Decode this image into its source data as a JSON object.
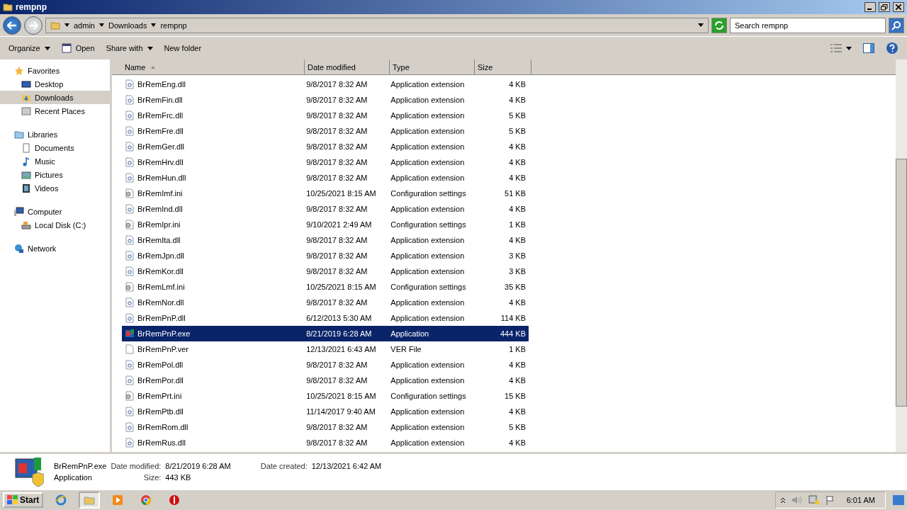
{
  "window": {
    "title": "rempnp"
  },
  "address": {
    "crumbs": [
      "admin",
      "Downloads",
      "rempnp"
    ],
    "search_placeholder": "Search rempnp"
  },
  "toolbar": [
    {
      "label": "Organize",
      "dropdown": true,
      "kind": "menu"
    },
    {
      "label": "Open",
      "dropdown": false,
      "kind": "open"
    },
    {
      "label": "Share with",
      "dropdown": true,
      "kind": "menu"
    },
    {
      "label": "New folder",
      "dropdown": false,
      "kind": "menu"
    }
  ],
  "sidebar": {
    "groups": [
      {
        "label": "Favorites",
        "kind": "star",
        "children": [
          {
            "label": "Desktop",
            "kind": "desktop",
            "selected": false
          },
          {
            "label": "Downloads",
            "kind": "downloads",
            "selected": true
          },
          {
            "label": "Recent Places",
            "kind": "recent",
            "selected": false
          }
        ]
      },
      {
        "label": "Libraries",
        "kind": "library",
        "children": [
          {
            "label": "Documents",
            "kind": "documents",
            "selected": false
          },
          {
            "label": "Music",
            "kind": "music",
            "selected": false
          },
          {
            "label": "Pictures",
            "kind": "pictures",
            "selected": false
          },
          {
            "label": "Videos",
            "kind": "videos",
            "selected": false
          }
        ]
      },
      {
        "label": "Computer",
        "kind": "computer",
        "children": [
          {
            "label": "Local Disk (C:)",
            "kind": "disk",
            "selected": false
          }
        ]
      },
      {
        "label": "Network",
        "kind": "network"
      }
    ]
  },
  "table": {
    "columns": [
      {
        "label": "Name",
        "sorted": true
      },
      {
        "label": "Date modified",
        "sorted": false
      },
      {
        "label": "Type",
        "sorted": false
      },
      {
        "label": "Size",
        "sorted": false
      }
    ],
    "rows": [
      {
        "name": "BrRemEng.dll",
        "date": "9/8/2017 8:32 AM",
        "type": "Application extension",
        "size": "4 KB",
        "kind": "dll",
        "selected": false
      },
      {
        "name": "BrRemFin.dll",
        "date": "9/8/2017 8:32 AM",
        "type": "Application extension",
        "size": "4 KB",
        "kind": "dll",
        "selected": false
      },
      {
        "name": "BrRemFrc.dll",
        "date": "9/8/2017 8:32 AM",
        "type": "Application extension",
        "size": "5 KB",
        "kind": "dll",
        "selected": false
      },
      {
        "name": "BrRemFre.dll",
        "date": "9/8/2017 8:32 AM",
        "type": "Application extension",
        "size": "5 KB",
        "kind": "dll",
        "selected": false
      },
      {
        "name": "BrRemGer.dll",
        "date": "9/8/2017 8:32 AM",
        "type": "Application extension",
        "size": "4 KB",
        "kind": "dll",
        "selected": false
      },
      {
        "name": "BrRemHrv.dll",
        "date": "9/8/2017 8:32 AM",
        "type": "Application extension",
        "size": "4 KB",
        "kind": "dll",
        "selected": false
      },
      {
        "name": "BrRemHun.dll",
        "date": "9/8/2017 8:32 AM",
        "type": "Application extension",
        "size": "4 KB",
        "kind": "dll",
        "selected": false
      },
      {
        "name": "BrRemImf.ini",
        "date": "10/25/2021 8:15 AM",
        "type": "Configuration settings",
        "size": "51 KB",
        "kind": "ini",
        "selected": false
      },
      {
        "name": "BrRemInd.dll",
        "date": "9/8/2017 8:32 AM",
        "type": "Application extension",
        "size": "4 KB",
        "kind": "dll",
        "selected": false
      },
      {
        "name": "BrRemIpr.ini",
        "date": "9/10/2021 2:49 AM",
        "type": "Configuration settings",
        "size": "1 KB",
        "kind": "ini",
        "selected": false
      },
      {
        "name": "BrRemIta.dll",
        "date": "9/8/2017 8:32 AM",
        "type": "Application extension",
        "size": "4 KB",
        "kind": "dll",
        "selected": false
      },
      {
        "name": "BrRemJpn.dll",
        "date": "9/8/2017 8:32 AM",
        "type": "Application extension",
        "size": "3 KB",
        "kind": "dll",
        "selected": false
      },
      {
        "name": "BrRemKor.dll",
        "date": "9/8/2017 8:32 AM",
        "type": "Application extension",
        "size": "3 KB",
        "kind": "dll",
        "selected": false
      },
      {
        "name": "BrRemLmf.ini",
        "date": "10/25/2021 8:15 AM",
        "type": "Configuration settings",
        "size": "35 KB",
        "kind": "ini",
        "selected": false
      },
      {
        "name": "BrRemNor.dll",
        "date": "9/8/2017 8:32 AM",
        "type": "Application extension",
        "size": "4 KB",
        "kind": "dll",
        "selected": false
      },
      {
        "name": "BrRemPnP.dll",
        "date": "6/12/2013 5:30 AM",
        "type": "Application extension",
        "size": "114 KB",
        "kind": "dll",
        "selected": false
      },
      {
        "name": "BrRemPnP.exe",
        "date": "8/21/2019 6:28 AM",
        "type": "Application",
        "size": "444 KB",
        "kind": "exe",
        "selected": true
      },
      {
        "name": "BrRemPnP.ver",
        "date": "12/13/2021 6:43 AM",
        "type": "VER File",
        "size": "1 KB",
        "kind": "ver",
        "selected": false
      },
      {
        "name": "BrRemPol.dll",
        "date": "9/8/2017 8:32 AM",
        "type": "Application extension",
        "size": "4 KB",
        "kind": "dll",
        "selected": false
      },
      {
        "name": "BrRemPor.dll",
        "date": "9/8/2017 8:32 AM",
        "type": "Application extension",
        "size": "4 KB",
        "kind": "dll",
        "selected": false
      },
      {
        "name": "BrRemPrt.ini",
        "date": "10/25/2021 8:15 AM",
        "type": "Configuration settings",
        "size": "15 KB",
        "kind": "ini",
        "selected": false
      },
      {
        "name": "BrRemPtb.dll",
        "date": "11/14/2017 9:40 AM",
        "type": "Application extension",
        "size": "4 KB",
        "kind": "dll",
        "selected": false
      },
      {
        "name": "BrRemRom.dll",
        "date": "9/8/2017 8:32 AM",
        "type": "Application extension",
        "size": "5 KB",
        "kind": "dll",
        "selected": false
      },
      {
        "name": "BrRemRus.dll",
        "date": "9/8/2017 8:32 AM",
        "type": "Application extension",
        "size": "4 KB",
        "kind": "dll",
        "selected": false
      }
    ]
  },
  "details": {
    "name": "BrRemPnP.exe",
    "type": "Application",
    "modified_label": "Date modified:",
    "modified": "8/21/2019 6:28 AM",
    "created_label": "Date created:",
    "created": "12/13/2021 6:42 AM",
    "size_label": "Size:",
    "size": "443 KB"
  },
  "taskbar": {
    "start": "Start",
    "apps": [
      {
        "kind": "ie",
        "selected": false
      },
      {
        "kind": "explorer",
        "selected": true
      },
      {
        "kind": "media",
        "selected": false
      },
      {
        "kind": "chrome",
        "selected": false
      },
      {
        "kind": "stop",
        "selected": false
      }
    ],
    "clock": "6:01 AM"
  }
}
